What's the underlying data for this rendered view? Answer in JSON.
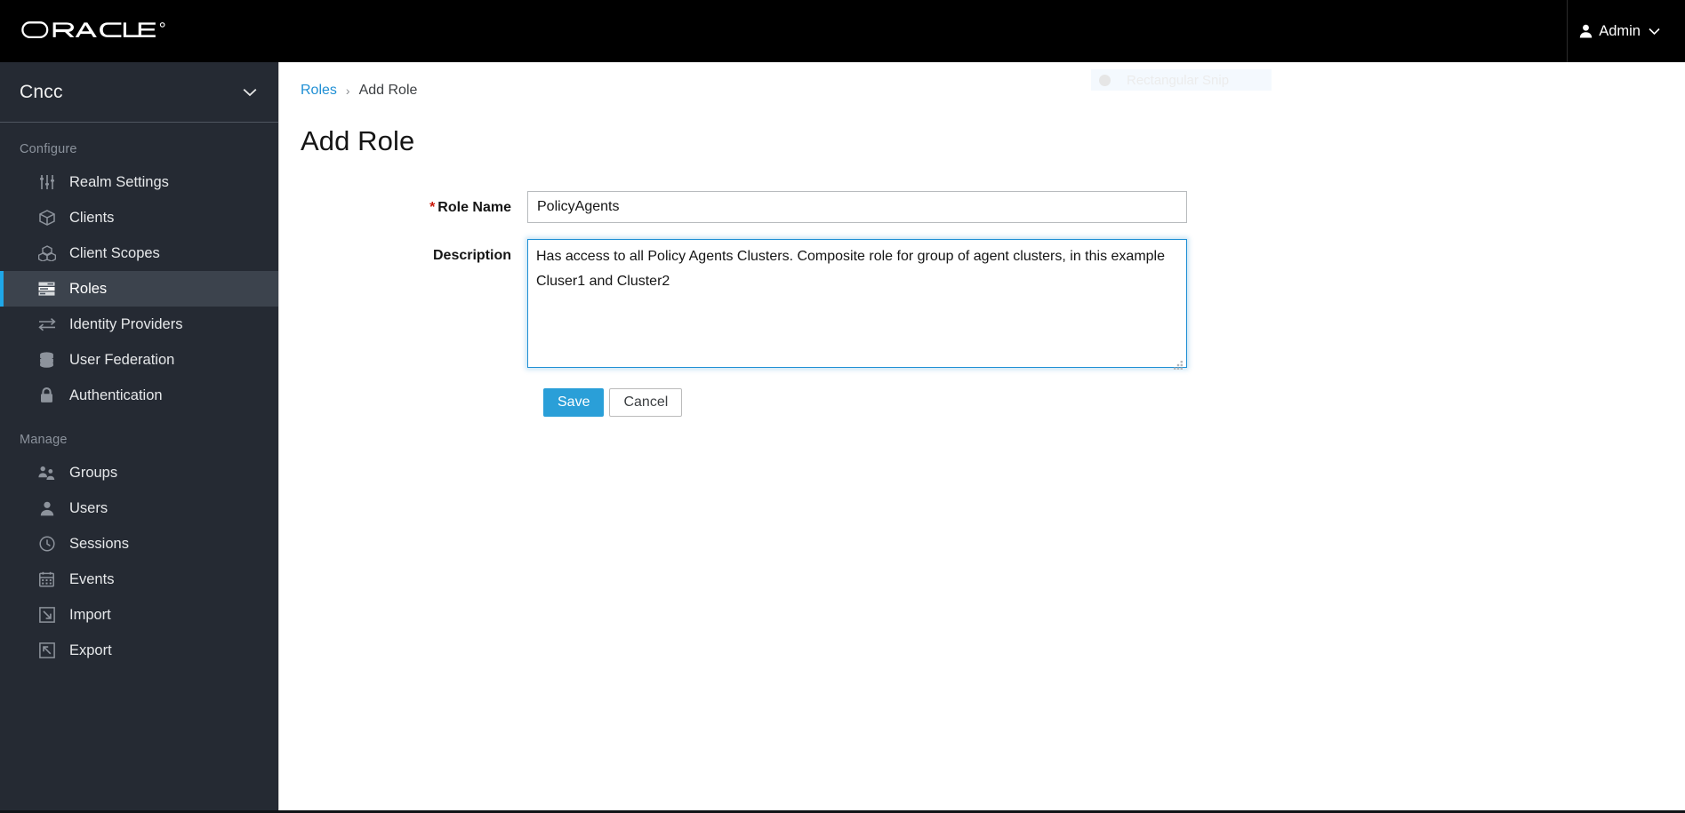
{
  "masthead": {
    "brand": "ORACLE",
    "brand_registered_mark": "®",
    "user_menu": {
      "label": "Admin",
      "user_icon": "user-icon",
      "caret_icon": "chevron-down-icon"
    }
  },
  "sidebar": {
    "realm": {
      "name": "Cncc",
      "caret_icon": "chevron-down-icon"
    },
    "sections": [
      {
        "title": "Configure",
        "items": [
          {
            "label": "Realm Settings",
            "icon": "sliders-icon",
            "active": false
          },
          {
            "label": "Clients",
            "icon": "cube-icon",
            "active": false
          },
          {
            "label": "Client Scopes",
            "icon": "cubes-icon",
            "active": false
          },
          {
            "label": "Roles",
            "icon": "list-rows-icon",
            "active": true
          },
          {
            "label": "Identity Providers",
            "icon": "exchange-arrows-icon",
            "active": false
          },
          {
            "label": "User Federation",
            "icon": "database-icon",
            "active": false
          },
          {
            "label": "Authentication",
            "icon": "lock-icon",
            "active": false
          }
        ]
      },
      {
        "title": "Manage",
        "items": [
          {
            "label": "Groups",
            "icon": "users-group-icon",
            "active": false
          },
          {
            "label": "Users",
            "icon": "user-icon",
            "active": false
          },
          {
            "label": "Sessions",
            "icon": "clock-icon",
            "active": false
          },
          {
            "label": "Events",
            "icon": "calendar-icon",
            "active": false
          },
          {
            "label": "Import",
            "icon": "import-arrow-icon",
            "active": false
          },
          {
            "label": "Export",
            "icon": "export-arrow-icon",
            "active": false
          }
        ]
      }
    ]
  },
  "content": {
    "breadcrumb": {
      "parent": "Roles",
      "separator": "›",
      "current": "Add Role"
    },
    "page_title": "Add Role",
    "form": {
      "role_name": {
        "label": "Role Name",
        "required_marker": "*",
        "value": "PolicyAgents",
        "placeholder": ""
      },
      "description": {
        "label": "Description",
        "value": "Has access to all Policy Agents Clusters. Composite role for group of agent clusters, in this example Cluser1 and Cluster2",
        "placeholder": "",
        "focused": true
      },
      "save_label": "Save",
      "cancel_label": "Cancel"
    }
  },
  "overlay": {
    "snip_label": "Rectangular Snip",
    "snip_icon": "circle-icon"
  },
  "colors": {
    "masthead_bg": "#000000",
    "sidebar_bg": "#252a33",
    "sidebar_active_bg": "#3c434d",
    "accent_blue": "#1fa7e8",
    "link_blue": "#1f8fd4",
    "primary_button": "#2a9fd8",
    "required_red": "#c9190b",
    "focus_border": "#1f8fd4"
  }
}
